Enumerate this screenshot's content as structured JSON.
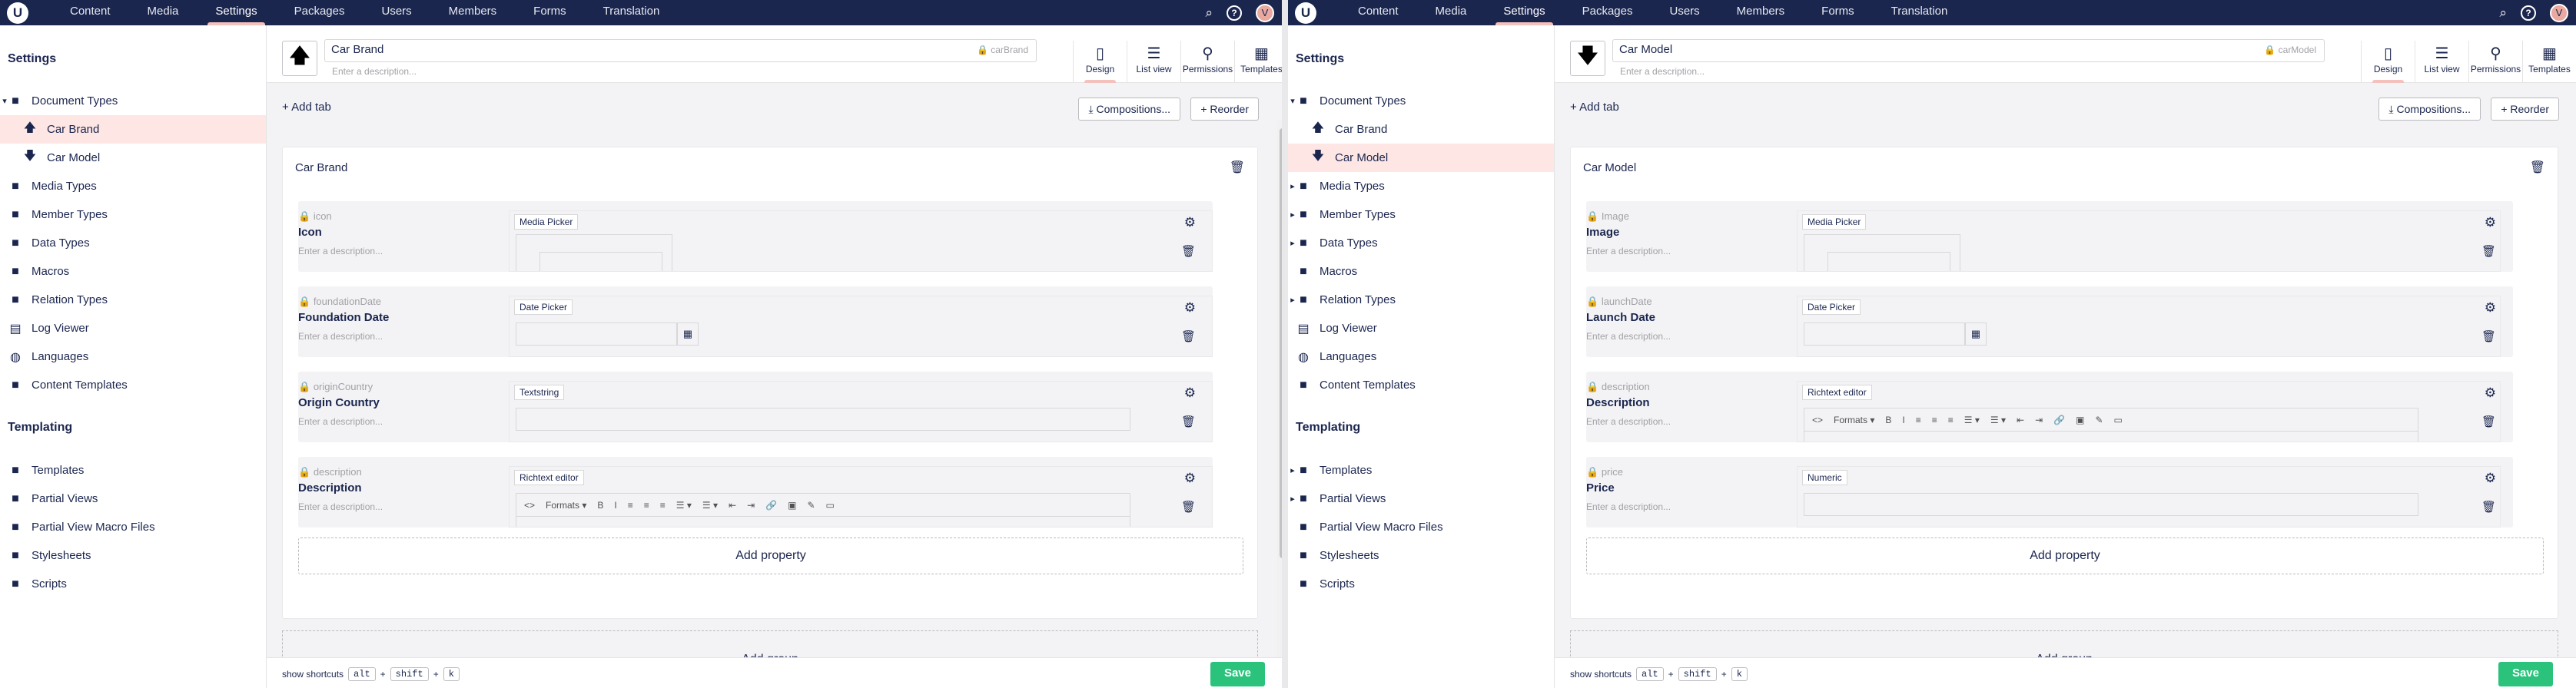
{
  "colors": {
    "topbar": "#1b264f",
    "accent": "#f5c1bc",
    "save": "#2bc37c",
    "selected": "#fde6e3"
  },
  "topnav": {
    "items": [
      "Content",
      "Media",
      "Settings",
      "Packages",
      "Users",
      "Members",
      "Forms",
      "Translation"
    ],
    "active_index": 2,
    "avatar": "V",
    "logo": "U",
    "help": "?",
    "search_icon": "⌕"
  },
  "sidebar": {
    "heading": "Settings",
    "templating_heading": "Templating",
    "document_types": "Document Types",
    "car_brand": "Car Brand",
    "car_model": "Car Model",
    "media_types": "Media Types",
    "member_types": "Member Types",
    "data_types": "Data Types",
    "macros": "Macros",
    "relation_types": "Relation Types",
    "log_viewer": "Log Viewer",
    "languages": "Languages",
    "content_templates": "Content Templates",
    "templates": "Templates",
    "partial_views": "Partial Views",
    "partial_view_macro_files": "Partial View Macro Files",
    "stylesheets": "Stylesheets",
    "scripts": "Scripts"
  },
  "common": {
    "description_placeholder": "Enter a description...",
    "add_tab": "Add tab",
    "compositions": "Compositions...",
    "reorder": "Reorder",
    "add_property": "Add property",
    "add_group": "Add group",
    "save": "Save",
    "show_shortcuts": "show shortcuts",
    "keys": [
      "alt",
      "shift",
      "k"
    ],
    "plus": "+",
    "apps": [
      "Design",
      "List view",
      "Permissions",
      "Templates"
    ],
    "rte_toolbar": [
      "<>",
      "Formats ▾",
      "B",
      "I",
      "≡",
      "≡",
      "≡",
      "☰ ▾",
      "☰ ▾",
      "⇤",
      "⇥",
      "🔗",
      "▣",
      "✎",
      "▭"
    ]
  },
  "panes": [
    {
      "doc_name": "Car Brand",
      "doc_alias": "carBrand",
      "doc_icon": "🡅",
      "group_name": "Car Brand",
      "props": [
        {
          "alias": "icon",
          "name": "Icon",
          "editor": "Media Picker"
        },
        {
          "alias": "foundationDate",
          "name": "Foundation Date",
          "editor": "Date Picker"
        },
        {
          "alias": "originCountry",
          "name": "Origin Country",
          "editor": "Textstring"
        },
        {
          "alias": "description",
          "name": "Description",
          "editor": "Richtext editor"
        }
      ]
    },
    {
      "doc_name": "Car Model",
      "doc_alias": "carModel",
      "doc_icon": "🡇",
      "group_name": "Car Model",
      "props": [
        {
          "alias": "Image",
          "name": "Image",
          "editor": "Media Picker"
        },
        {
          "alias": "launchDate",
          "name": "Launch Date",
          "editor": "Date Picker"
        },
        {
          "alias": "description",
          "name": "Description",
          "editor": "Richtext editor"
        },
        {
          "alias": "price",
          "name": "Price",
          "editor": "Numeric"
        }
      ]
    }
  ]
}
